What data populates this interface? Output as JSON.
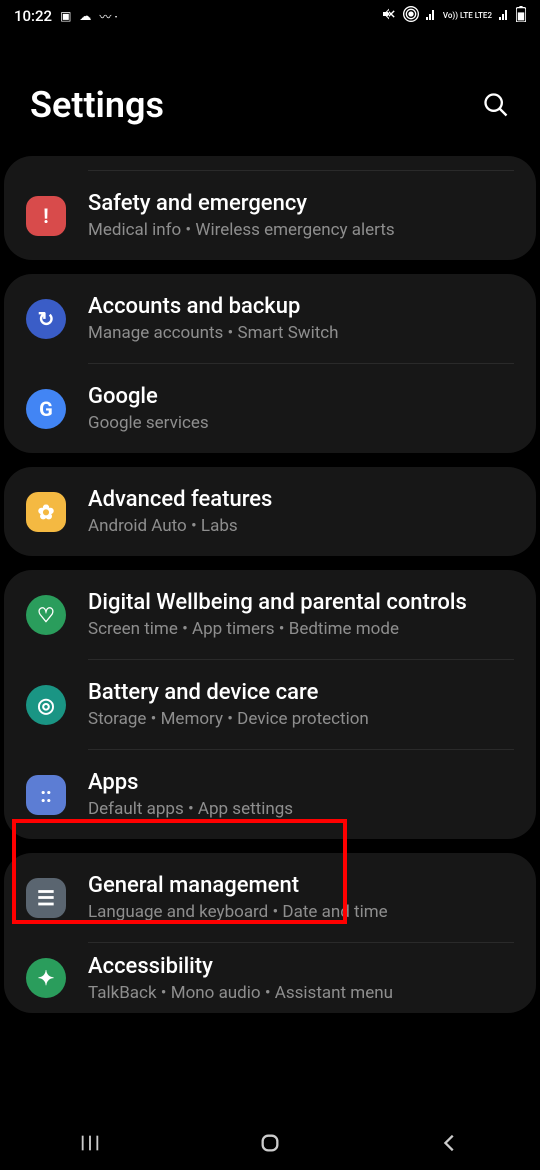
{
  "statusBar": {
    "time": "10:22",
    "networkLabel": "Vo)) LTE LTE2"
  },
  "header": {
    "title": "Settings"
  },
  "groups": [
    {
      "hasTopDivider": true,
      "items": [
        {
          "id": "safety",
          "title": "Safety and emergency",
          "subtitle": "Medical info  •  Wireless emergency alerts",
          "iconClass": "icon-safety",
          "iconGlyph": "!"
        }
      ]
    },
    {
      "items": [
        {
          "id": "accounts",
          "title": "Accounts and backup",
          "subtitle": "Manage accounts  •  Smart Switch",
          "iconClass": "icon-accounts",
          "iconGlyph": "↻"
        },
        {
          "id": "google",
          "title": "Google",
          "subtitle": "Google services",
          "iconClass": "icon-google",
          "iconGlyph": "G"
        }
      ]
    },
    {
      "items": [
        {
          "id": "advanced",
          "title": "Advanced features",
          "subtitle": "Android Auto  •  Labs",
          "iconClass": "icon-advanced",
          "iconGlyph": "✿"
        }
      ]
    },
    {
      "items": [
        {
          "id": "wellbeing",
          "title": "Digital Wellbeing and parental controls",
          "subtitle": "Screen time  •  App timers  •  Bedtime mode",
          "iconClass": "icon-wellbeing",
          "iconGlyph": "♡"
        },
        {
          "id": "battery",
          "title": "Battery and device care",
          "subtitle": "Storage  •  Memory  •  Device protection",
          "iconClass": "icon-battery",
          "iconGlyph": "◎"
        },
        {
          "id": "apps",
          "title": "Apps",
          "subtitle": "Default apps  •  App settings",
          "iconClass": "icon-apps",
          "iconGlyph": "::"
        }
      ]
    },
    {
      "items": [
        {
          "id": "general",
          "title": "General management",
          "subtitle": "Language and keyboard  •  Date and time",
          "iconClass": "icon-general",
          "iconGlyph": "☰"
        },
        {
          "id": "accessibility",
          "title": "Accessibility",
          "subtitle": "TalkBack  •  Mono audio  •  Assistant menu",
          "iconClass": "icon-accessibility",
          "iconGlyph": "✦",
          "cut": true
        }
      ]
    }
  ]
}
